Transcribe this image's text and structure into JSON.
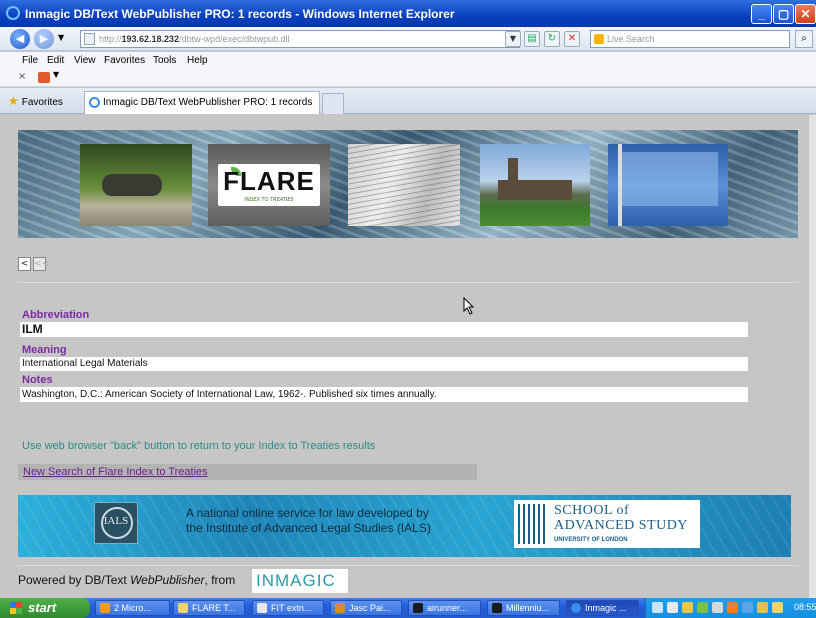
{
  "window": {
    "title": "Inmagic DB/Text WebPublisher PRO: 1 records - Windows Internet Explorer"
  },
  "address_bar": {
    "url_prefix": "http://",
    "url_host": "193.62.18.232",
    "url_path": "/dbtw-wpd/exec/dbtwpub.dll",
    "live_search_placeholder": "Live Search"
  },
  "menu": {
    "items": [
      "File",
      "Edit",
      "View",
      "Favorites",
      "Tools",
      "Help"
    ]
  },
  "tabs": {
    "favorites_label": "Favorites",
    "active_tab_label": "Inmagic DB/Text WebPublisher PRO: 1 records"
  },
  "banner": {
    "logo_text": "FLARE",
    "logo_tagline": "INDEX TO TREATIES"
  },
  "pager": {
    "prev_label": "<",
    "first_label": "<<"
  },
  "record": {
    "fields": [
      {
        "label": "Abbreviation",
        "value": "ILM"
      },
      {
        "label": "Meaning",
        "value": "International Legal Materials"
      },
      {
        "label": "Notes",
        "value": "Washington, D.C.: American Society of International Law, 1962-. Published six times annually."
      }
    ]
  },
  "footer": {
    "back_note": "Use web browser \"back\" button to return to your Index to Treaties results",
    "new_search_link": "New Search of Flare Index to Treaties",
    "ials": {
      "line1": "A national online service for law developed by",
      "line2": "the Institute of Advanced Legal Studies (IALS)",
      "logo_monogram": "IALS",
      "school_line1": "SCHOOL of",
      "school_line2": "ADVANCED STUDY",
      "university": "UNIVERSITY OF LONDON"
    },
    "powered_prefix": "Powered by DB/Text ",
    "powered_product": "WebPublisher",
    "powered_suffix": ", from",
    "inmagic_logo": "INMAGIC"
  },
  "taskbar": {
    "start_label": "start",
    "tasks": [
      "2 Micro...",
      "FLARE T...",
      "FIT extn...",
      "Jasc Pai...",
      "airunner...",
      "Millenniu...",
      "Inmagic ..."
    ],
    "clock": "08:55"
  }
}
